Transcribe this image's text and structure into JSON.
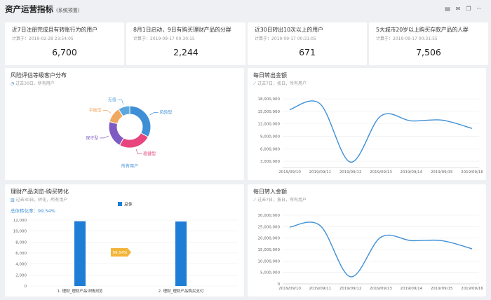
{
  "header": {
    "title": "资产运营指标",
    "subtitle": "(系统预置)",
    "icons": [
      "list-icon",
      "mail-icon",
      "copy-icon",
      "more-icon"
    ]
  },
  "kpis": [
    {
      "title": "近7日注册完成且有转账行为的用户",
      "sub": "计算于：2019-02-28 23:54:05",
      "value": "6,700"
    },
    {
      "title": "8月1日启动，9日有购买理财产品的分群",
      "sub": "计算于：2019-09-17 00:30:15",
      "value": "2,244"
    },
    {
      "title": "近30日转出10次以上的用户",
      "sub": "计算于：2019-09-17 00:31:05",
      "value": "671"
    },
    {
      "title": "5大城市20岁以上购买存款产品的人群",
      "sub": "计算于：2019-09-17 00:31:55",
      "value": "7,506"
    }
  ],
  "panels": {
    "risk": {
      "title": "风险评估等级客户分布",
      "sub": "过去30日，所有用户"
    },
    "out": {
      "title": "每日转出金额",
      "sub": "过去7日，按日，所有用户"
    },
    "funnel": {
      "title": "理财产品浏览-购买转化",
      "sub": "过去30日，转化，所有用户",
      "rate": "总体转化率：99.54%"
    },
    "inflow": {
      "title": "每日转入金额",
      "sub": "过去7日，按日，所有用户"
    }
  },
  "chart_data": [
    {
      "type": "pie",
      "donut": true,
      "categories": [
        "风险型",
        "稳健型",
        "保守型",
        "平衡型",
        "无值"
      ],
      "values": [
        33,
        25,
        21,
        12,
        9
      ],
      "colors": [
        "#3d8fd6",
        "#e8457e",
        "#7e5bc2",
        "#f0a860",
        "#5da7df"
      ],
      "footer": "所有用户"
    },
    {
      "type": "line",
      "x": [
        "2019/09/10",
        "2019/09/11",
        "2019/09/12",
        "2019/09/13",
        "2019/09/14",
        "2019/09/15",
        "2019/09/16"
      ],
      "yticks": [
        "3,000,000",
        "6,000,000",
        "9,000,000",
        "12,000,000",
        "15,000,000",
        "18,000,000"
      ],
      "ylim": [
        1500000,
        18000000
      ],
      "values": [
        15400000,
        16800000,
        2800000,
        13900000,
        12700000,
        12900000,
        10900000
      ],
      "color": "#3d8fd6"
    },
    {
      "type": "bar",
      "legend": "总体",
      "categories": [
        "1. 理财_理财产品详情浏览",
        "2. 理财_理财产品购买支付"
      ],
      "yticks": [
        "0",
        "2,000",
        "4,000",
        "6,000",
        "8,000",
        "10,000",
        "12,000"
      ],
      "ylim": [
        0,
        12000
      ],
      "values": [
        11800,
        11750
      ],
      "conversion_label": "99.54%",
      "color": "#1e7ed6"
    },
    {
      "type": "line",
      "x": [
        "2019/09/10",
        "2019/09/11",
        "2019/09/12",
        "2019/09/13",
        "2019/09/14",
        "2019/09/15",
        "2019/09/16"
      ],
      "yticks": [
        "0",
        "5,000,000",
        "10,000,000",
        "15,000,000",
        "20,000,000",
        "25,000,000",
        "30,000,000"
      ],
      "ylim": [
        0,
        30000000
      ],
      "values": [
        24800000,
        25500000,
        3100000,
        20400000,
        18900000,
        18900000,
        15300000
      ],
      "color": "#3d8fd6"
    }
  ]
}
